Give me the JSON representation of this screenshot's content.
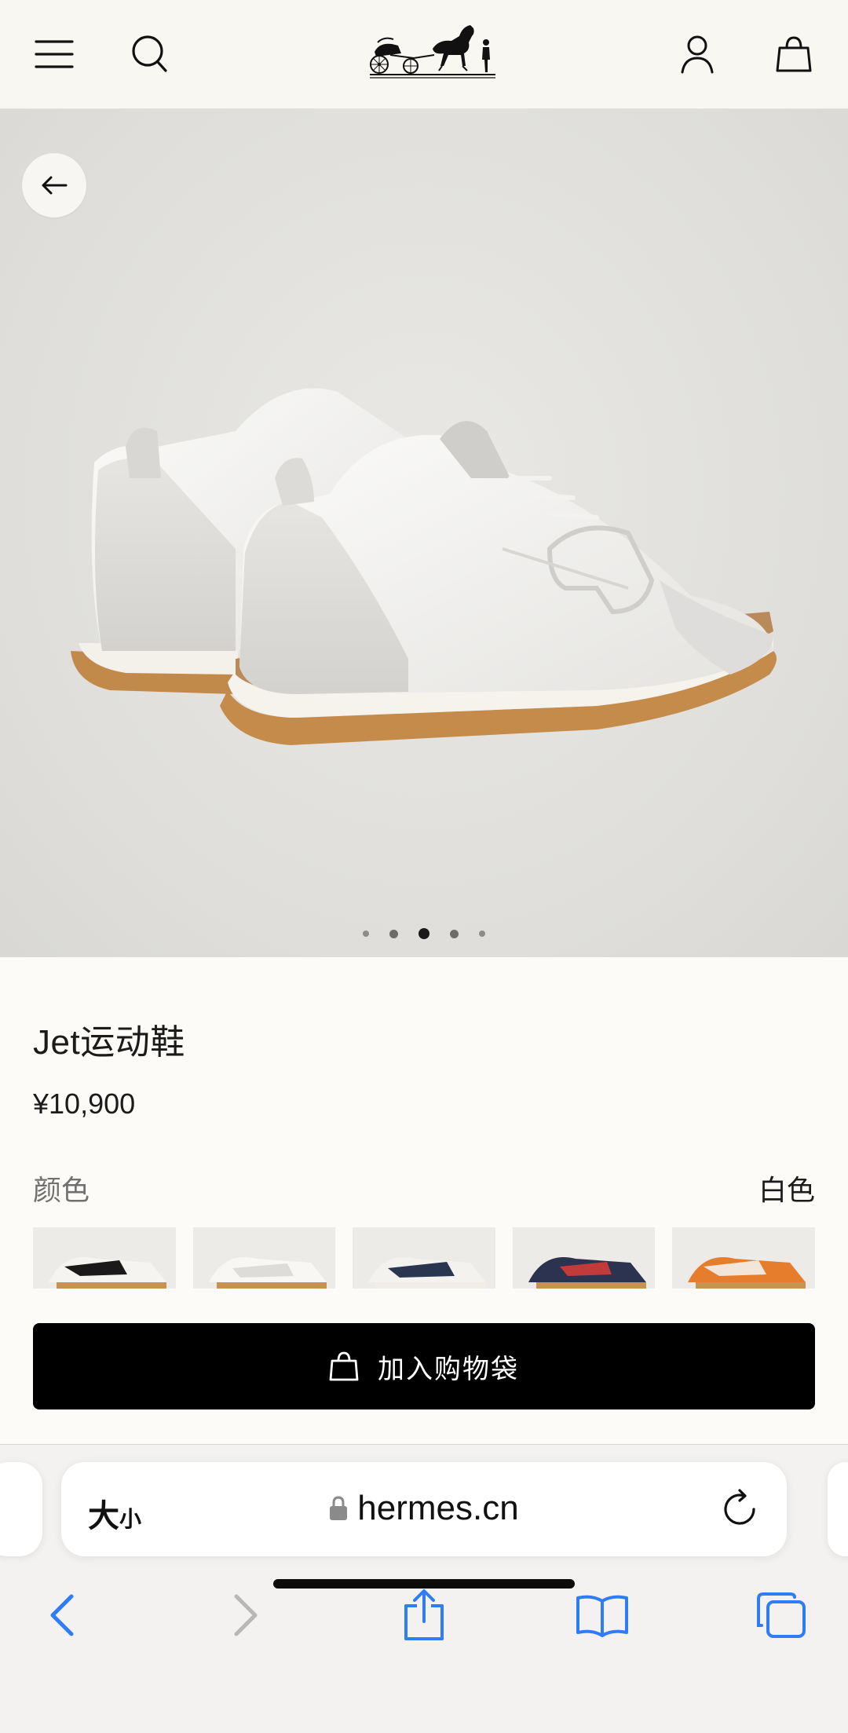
{
  "header": {
    "menu_icon": "hamburger-menu-icon",
    "search_icon": "search-icon",
    "logo": "hermes-carriage-logo",
    "account_icon": "user-icon",
    "bag_icon": "shopping-bag-icon"
  },
  "gallery": {
    "back_icon": "arrow-left-icon",
    "dot_count": 5,
    "active_dot": 3
  },
  "product": {
    "title": "Jet运动鞋",
    "price": "¥10,900",
    "color_label": "颜色",
    "color_value": "白色",
    "swatch_colors": [
      "black",
      "white",
      "navy",
      "navy-red",
      "orange"
    ],
    "add_to_bag": "加入购物袋"
  },
  "browser": {
    "text_size": "大",
    "text_size_small": "小",
    "url": "hermes.cn",
    "accent": "#2f7cf6"
  }
}
